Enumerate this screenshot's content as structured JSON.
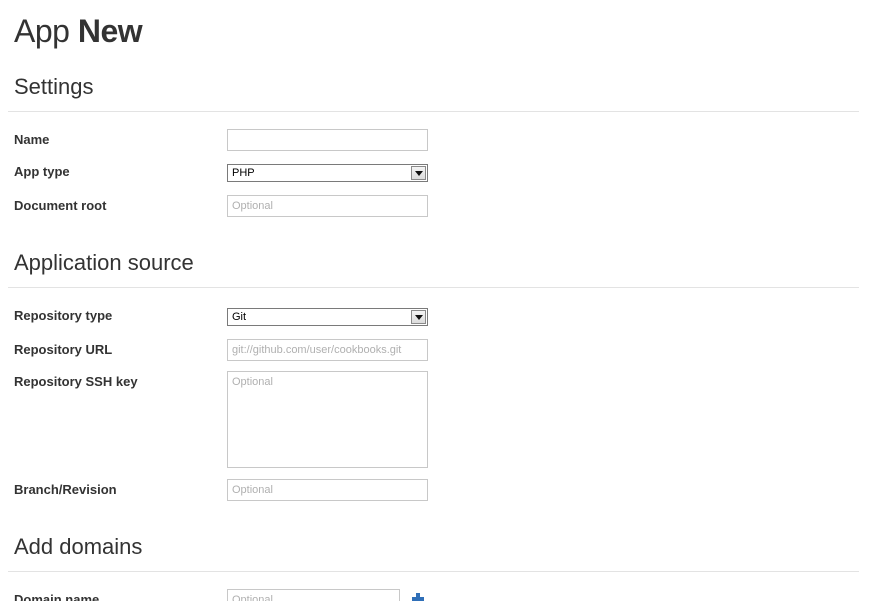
{
  "page": {
    "title_prefix": "App",
    "title_emphasis": "New"
  },
  "settings": {
    "heading": "Settings",
    "name_label": "Name",
    "name_value": "",
    "app_type_label": "App type",
    "app_type_selected": "PHP",
    "document_root_label": "Document root",
    "document_root_placeholder": "Optional"
  },
  "application_source": {
    "heading": "Application source",
    "repository_type_label": "Repository type",
    "repository_type_selected": "Git",
    "repository_url_label": "Repository URL",
    "repository_url_placeholder": "git://github.com/user/cookbooks.git",
    "repository_ssh_key_label": "Repository SSH key",
    "repository_ssh_key_placeholder": "Optional",
    "branch_revision_label": "Branch/Revision",
    "branch_revision_placeholder": "Optional"
  },
  "add_domains": {
    "heading": "Add domains",
    "domain_name_label": "Domain name",
    "domain_name_placeholder": "Optional",
    "add_icon": "plus-icon"
  },
  "colors": {
    "accent_icon": "#2f6fb8",
    "divider": "#e3e3e3",
    "text": "#333333",
    "placeholder": "#b0b0b0"
  }
}
